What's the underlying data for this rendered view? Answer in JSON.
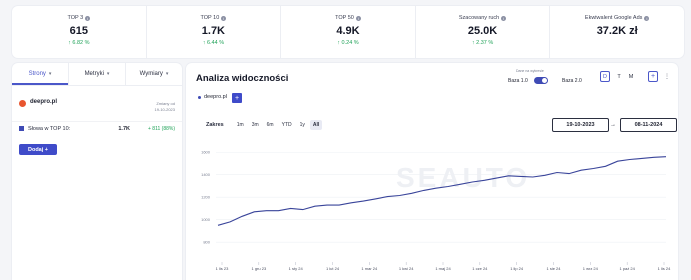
{
  "stats": [
    {
      "label": "TOP 3",
      "value": "615",
      "change": "↑ 6.82 %"
    },
    {
      "label": "TOP 10",
      "value": "1.7K",
      "change": "↑ 6.44 %"
    },
    {
      "label": "TOP 50",
      "value": "4.9K",
      "change": "↑ 0.24 %"
    },
    {
      "label": "Szacowany ruch",
      "value": "25.0K",
      "change": "↑ 2.37 %"
    },
    {
      "label": "Ekwiwalent Google Ads",
      "value": "37.2K zł",
      "change": ""
    }
  ],
  "left_panel": {
    "tabs": [
      "Strony",
      "Metryki",
      "Wymiary"
    ],
    "domain": "deepro.pl",
    "changed_label": "Zmiany od",
    "changed_date": "19-10-2023",
    "keyword_label": "Słowa w TOP 10:",
    "keyword_value": "1.7K",
    "keyword_change": "+ 811 (88%)",
    "add_button": "Dodaj +"
  },
  "main": {
    "title": "Analiza widoczności",
    "base_caption": "Dane na wykresie",
    "base1": "Baza 1.0",
    "base2": "Baza 2.0",
    "periods": [
      "D",
      "T",
      "M"
    ],
    "selected_period": "D",
    "domain_chip": "deepro.pl",
    "range_label": "Zakres",
    "ranges": [
      "1m",
      "3m",
      "6m",
      "YTD",
      "1y",
      "All"
    ],
    "active_range": "All",
    "date_from": "19-10-2023",
    "date_to": "08-11-2024",
    "watermark": "SEAUTO"
  },
  "chart_data": {
    "type": "line",
    "x_tick_labels": [
      "1 lis 23",
      "1 gru 23",
      "1 sty 24",
      "1 lut 24",
      "1 mar 24",
      "1 kwi 24",
      "1 maj 24",
      "1 cze 24",
      "1 lip 24",
      "1 sie 24",
      "1 wrz 24",
      "1 paź 24",
      "1 lis 24"
    ],
    "y_ticks": [
      800,
      1000,
      1200,
      1400,
      1600
    ],
    "ylim": [
      650,
      1700
    ],
    "series": [
      {
        "values": [
          950,
          980,
          1030,
          1070,
          1080,
          1080,
          1100,
          1090,
          1120,
          1130,
          1130,
          1150,
          1165,
          1185,
          1205,
          1215,
          1235,
          1260,
          1280,
          1295,
          1315,
          1335,
          1350,
          1370,
          1390,
          1385,
          1380,
          1395,
          1420,
          1410,
          1440,
          1455,
          1475,
          1520,
          1535,
          1545,
          1555,
          1560
        ],
        "color": "#39449a"
      }
    ]
  }
}
